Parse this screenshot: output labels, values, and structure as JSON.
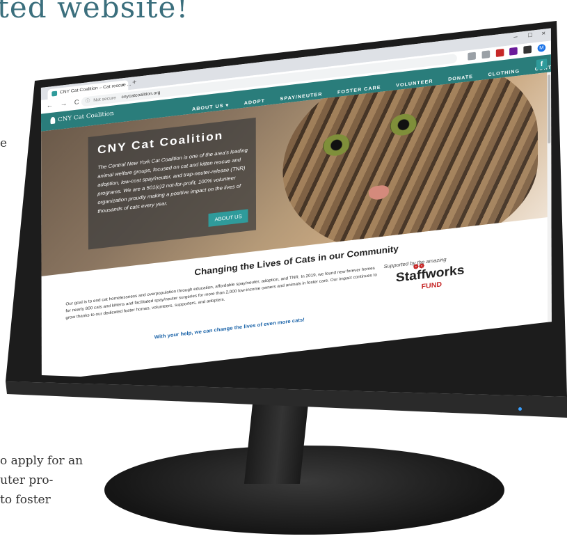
{
  "page": {
    "heading": "ted website!",
    "side_fragments": [
      "e",
      "o apply for an",
      "uter pro-",
      "to foster"
    ]
  },
  "browser": {
    "tab_title": "CNY Cat Coalition – Cat rescue ...",
    "tab_close": "×",
    "new_tab": "+",
    "window_controls": [
      "–",
      "□",
      "×"
    ],
    "nav_icons": "← → C ⌂",
    "not_secure": "Not secure",
    "url": "cnycatcoalition.org",
    "profile_initial": "M"
  },
  "site": {
    "logo_text": "CNY Cat Coalition",
    "nav": [
      "ABOUT US ▾",
      "ADOPT",
      "SPAY/NEUTER",
      "FOSTER CARE",
      "VOLUNTEER",
      "DONATE",
      "CLOTHING",
      "CONTACT"
    ],
    "facebook_glyph": "f",
    "hero": {
      "title": "CNY Cat Coalition",
      "text": "The Central New York Cat Coalition is one of the area's leading animal welfare groups, focused on cat and kitten rescue and adoption, low-cost spay/neuter, and trap-neuter-release (TNR) programs. We are a 501(c)3 not-for-profit, 100% volunteer organization proudly making a positive impact on the lives of thousands of cats every year.",
      "button": "ABOUT US"
    },
    "section_heading": "Changing the Lives of Cats in our Community",
    "body": "Our goal is to end cat homelessness and overpopulation through education, affordable spay/neuter, adoption, and TNR. In 2019, we found new forever homes for nearly 800 cats and kittens and facilitated spay/neuter surgeries for more than 2,000 low-income owners and animals in foster care. Our impact continues to grow thanks to our dedicated foster homes, volunteers, supporters, and adopters.",
    "tagline": "With your help, we can change the lives of even more cats!",
    "sponsor_line": "Supported by the amazing",
    "sponsor_name": "Staffworks",
    "sponsor_fund": "FUND"
  }
}
